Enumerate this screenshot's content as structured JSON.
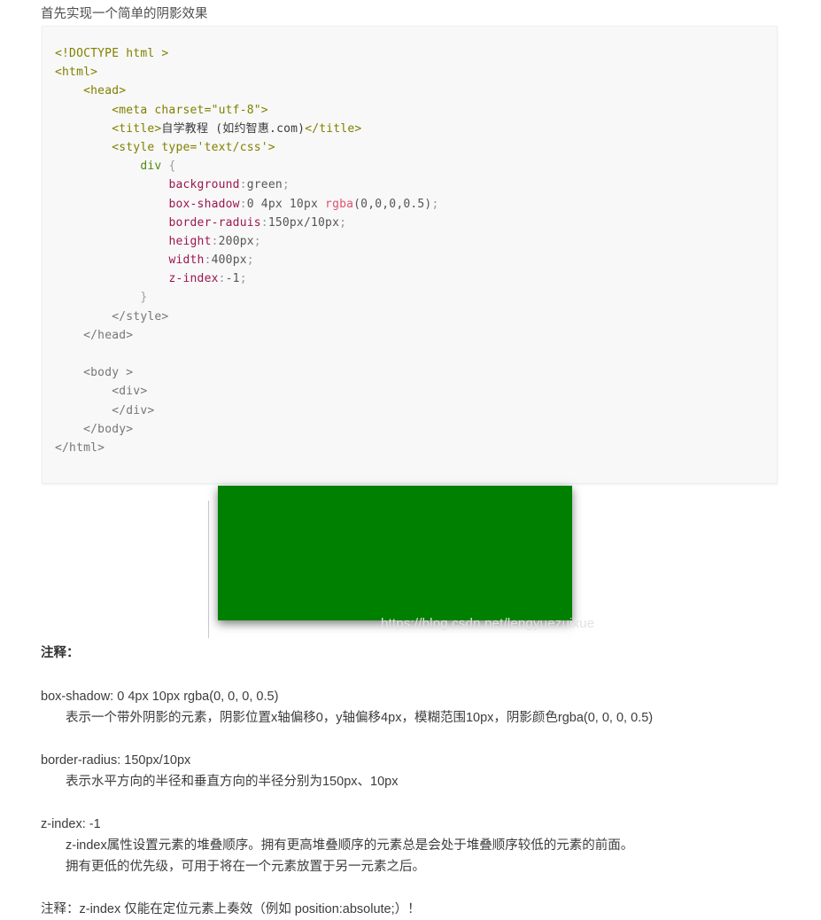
{
  "page": {
    "heading": "首先实现一个简单的阴影效果"
  },
  "code_block": {
    "lines": [
      {
        "id": "doctype",
        "indent": 0,
        "tokens": [
          {
            "cls": "tok-tag",
            "text": "<!DOCTYPE html >"
          }
        ]
      },
      {
        "id": "html-open",
        "indent": 0,
        "tokens": [
          {
            "cls": "tok-tag",
            "text": "<html>"
          }
        ]
      },
      {
        "id": "head-open",
        "indent": 1,
        "tokens": [
          {
            "cls": "tok-tag",
            "text": "<head>"
          }
        ]
      },
      {
        "id": "meta",
        "indent": 2,
        "tokens": [
          {
            "cls": "tok-tag",
            "text": "<meta charset=\"utf-8\">"
          }
        ]
      },
      {
        "id": "title",
        "indent": 2,
        "tokens": [
          {
            "cls": "tok-tag",
            "text": "<title>"
          },
          {
            "cls": "tok-cntext",
            "text": "自学教程 (如约智惠.com)"
          },
          {
            "cls": "tok-tag",
            "text": "</title>"
          }
        ]
      },
      {
        "id": "style-open",
        "indent": 2,
        "tokens": [
          {
            "cls": "tok-tag",
            "text": "<style type='text/css'>"
          }
        ]
      },
      {
        "id": "selector",
        "indent": 3,
        "tokens": [
          {
            "cls": "tok-sel",
            "text": "div"
          },
          {
            "cls": "tok-val",
            "text": " "
          },
          {
            "cls": "tok-brace",
            "text": "{"
          }
        ]
      },
      {
        "id": "background",
        "indent": 4,
        "tokens": [
          {
            "cls": "tok-prop",
            "text": "background"
          },
          {
            "cls": "tok-punc",
            "text": ":"
          },
          {
            "cls": "tok-val",
            "text": "green"
          },
          {
            "cls": "tok-punc",
            "text": ";"
          }
        ]
      },
      {
        "id": "box-shadow",
        "indent": 4,
        "tokens": [
          {
            "cls": "tok-prop",
            "text": "box-shadow"
          },
          {
            "cls": "tok-punc",
            "text": ":"
          },
          {
            "cls": "tok-val",
            "text": "0 4px 10px "
          },
          {
            "cls": "tok-fn",
            "text": "rgba"
          },
          {
            "cls": "tok-val",
            "text": "(0,0,0,0.5)"
          },
          {
            "cls": "tok-punc",
            "text": ";"
          }
        ]
      },
      {
        "id": "border-radius",
        "indent": 4,
        "tokens": [
          {
            "cls": "tok-prop",
            "text": "border-raduis"
          },
          {
            "cls": "tok-punc",
            "text": ":"
          },
          {
            "cls": "tok-val",
            "text": "150px/10px"
          },
          {
            "cls": "tok-punc",
            "text": ";"
          }
        ]
      },
      {
        "id": "height",
        "indent": 4,
        "tokens": [
          {
            "cls": "tok-prop",
            "text": "height"
          },
          {
            "cls": "tok-punc",
            "text": ":"
          },
          {
            "cls": "tok-val",
            "text": "200px"
          },
          {
            "cls": "tok-punc",
            "text": ";"
          }
        ]
      },
      {
        "id": "width",
        "indent": 4,
        "tokens": [
          {
            "cls": "tok-prop",
            "text": "width"
          },
          {
            "cls": "tok-punc",
            "text": ":"
          },
          {
            "cls": "tok-val",
            "text": "400px"
          },
          {
            "cls": "tok-punc",
            "text": ";"
          }
        ]
      },
      {
        "id": "z-index",
        "indent": 4,
        "tokens": [
          {
            "cls": "tok-prop",
            "text": "z-index"
          },
          {
            "cls": "tok-punc",
            "text": ":"
          },
          {
            "cls": "tok-val",
            "text": "-1"
          },
          {
            "cls": "tok-punc",
            "text": ";"
          }
        ]
      },
      {
        "id": "rule-close",
        "indent": 3,
        "tokens": [
          {
            "cls": "tok-brace",
            "text": "}"
          }
        ]
      },
      {
        "id": "style-close",
        "indent": 2,
        "tokens": [
          {
            "cls": "tok-plain",
            "text": "</style>"
          }
        ]
      },
      {
        "id": "head-close",
        "indent": 1,
        "tokens": [
          {
            "cls": "tok-plain",
            "text": "</head>"
          }
        ]
      },
      {
        "id": "blank",
        "indent": 0,
        "tokens": [
          {
            "cls": "tok-plain",
            "text": ""
          }
        ]
      },
      {
        "id": "body-open",
        "indent": 1,
        "tokens": [
          {
            "cls": "tok-plain",
            "text": "<body >"
          }
        ]
      },
      {
        "id": "div-open",
        "indent": 2,
        "tokens": [
          {
            "cls": "tok-plain",
            "text": "<div>"
          }
        ]
      },
      {
        "id": "div-close",
        "indent": 2,
        "tokens": [
          {
            "cls": "tok-plain",
            "text": "</div>"
          }
        ]
      },
      {
        "id": "body-close",
        "indent": 1,
        "tokens": [
          {
            "cls": "tok-plain",
            "text": "</body>"
          }
        ]
      },
      {
        "id": "html-close",
        "indent": 0,
        "tokens": [
          {
            "cls": "tok-plain",
            "text": "</html>"
          }
        ]
      }
    ]
  },
  "demo": {
    "box_color": "#008000",
    "watermark": "https://blog.csdn.net/lengyuezuixue"
  },
  "notes": {
    "title": "注释：",
    "groups": [
      {
        "head": "box-shadow: 0 4px 10px rgba(0, 0, 0, 0.5)",
        "lines": [
          "表示一个带外阴影的元素，阴影位置x轴偏移0，y轴偏移4px，模糊范围10px，阴影颜色rgba(0, 0, 0, 0.5)"
        ]
      },
      {
        "head": "border-radius: 150px/10px",
        "lines": [
          "表示水平方向的半径和垂直方向的半径分别为150px、10px"
        ]
      },
      {
        "head": "z-index: -1",
        "lines": [
          "z-index属性设置元素的堆叠顺序。拥有更高堆叠顺序的元素总是会处于堆叠顺序较低的元素的前面。",
          "拥有更低的优先级，可用于将在一个元素放置于另一元素之后。"
        ]
      }
    ],
    "footer": "注释：z-index 仅能在定位元素上奏效（例如 position:absolute;）！"
  }
}
